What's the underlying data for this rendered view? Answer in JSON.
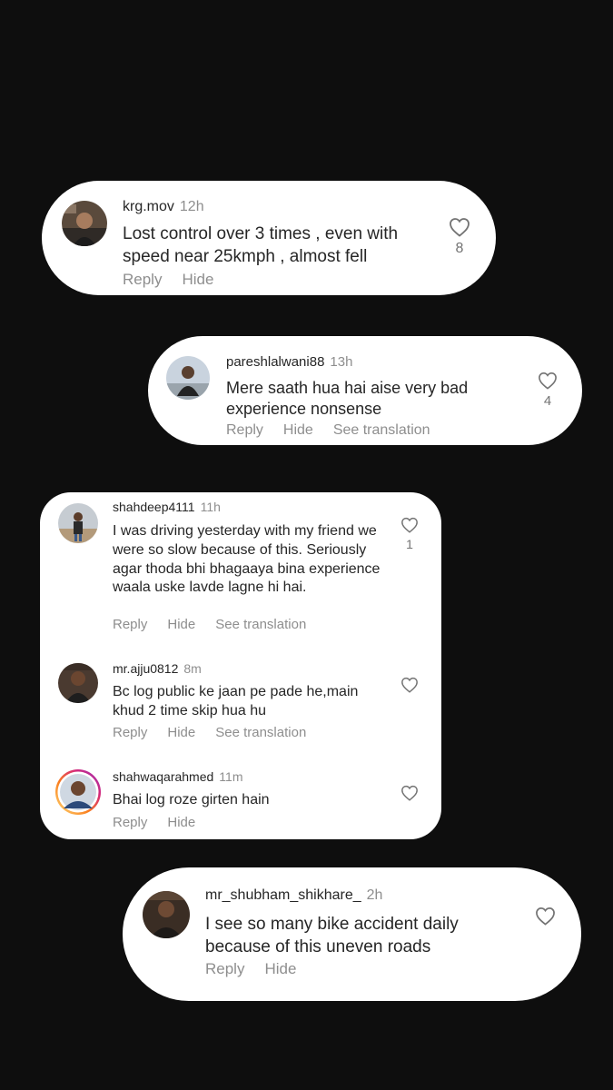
{
  "comments": {
    "c1": {
      "user": "krg.mov",
      "time": "12h",
      "text": "Lost control over 3 times , even with speed near 25kmph , almost fell",
      "likes": "8",
      "reply": "Reply",
      "hide": "Hide"
    },
    "c2": {
      "user": "pareshlalwani88",
      "time": "13h",
      "text": "Mere saath hua hai aise very bad experience nonsense",
      "likes": "4",
      "reply": "Reply",
      "hide": "Hide",
      "translate": "See translation"
    },
    "c3": {
      "user": "shahdeep4111",
      "time": "11h",
      "text": "I was driving yesterday with my friend we were so slow because of this. Seriously agar thoda bhi bhagaaya bina experience waala uske lavde lagne hi hai.",
      "likes": "1",
      "reply": "Reply",
      "hide": "Hide",
      "translate": "See translation"
    },
    "c4": {
      "user": "mr.ajju0812",
      "time": "8m",
      "text": "Bc log public ke jaan pe pade he,main khud 2 time skip hua hu",
      "reply": "Reply",
      "hide": "Hide",
      "translate": "See translation"
    },
    "c5": {
      "user": "shahwaqarahmed",
      "time": "11m",
      "text": "Bhai log roze girten hain",
      "reply": "Reply",
      "hide": "Hide"
    },
    "c6": {
      "user": "mr_shubham_shikhare_",
      "time": "2h",
      "text": "I see so many bike accident daily because of this uneven roads",
      "reply": "Reply",
      "hide": "Hide"
    }
  },
  "icons": {
    "like": "heart-outline-icon",
    "avatar": "user-avatar-photo"
  },
  "colors": {
    "background": "#0e0e0e",
    "card": "#ffffff",
    "text": "#262626",
    "muted": "#8e8e8e",
    "story_ring": "#d6249f"
  }
}
